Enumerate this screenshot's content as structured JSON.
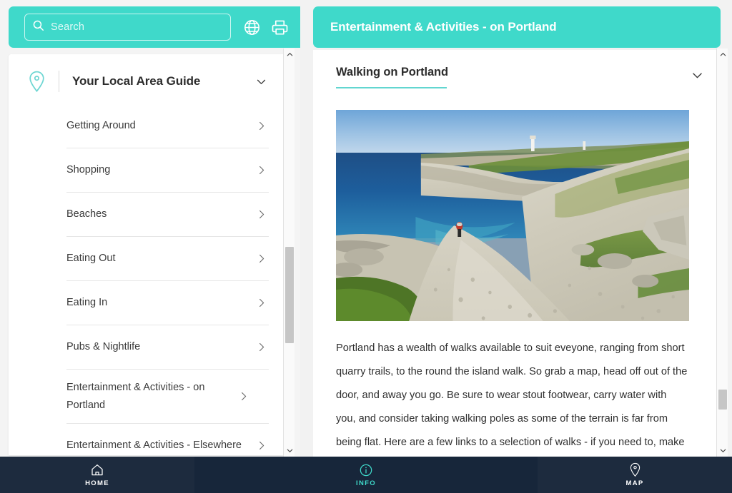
{
  "search": {
    "placeholder": "Search",
    "value": "",
    "icon": "search-icon"
  },
  "header_actions": [
    {
      "name": "globe-icon",
      "label": "Language"
    },
    {
      "name": "printer-icon",
      "label": "Print"
    }
  ],
  "sidebar": {
    "pin_icon": "location-pin-icon",
    "title": "Your Local Area Guide",
    "collapse_icon": "chevron-down-icon",
    "items": [
      {
        "label": "Getting Around",
        "chevron": "chevron-right-icon"
      },
      {
        "label": "Shopping",
        "chevron": "chevron-right-icon"
      },
      {
        "label": "Beaches",
        "chevron": "chevron-right-icon"
      },
      {
        "label": "Eating Out",
        "chevron": "chevron-right-icon"
      },
      {
        "label": "Eating In",
        "chevron": "chevron-right-icon"
      },
      {
        "label": "Pubs & Nightlife",
        "chevron": "chevron-right-icon"
      },
      {
        "label": "Entertainment & Activities - on Portland",
        "chevron": "chevron-right-icon"
      },
      {
        "label": "Entertainment & Activities - Elsewhere",
        "chevron": "chevron-right-icon"
      }
    ]
  },
  "content": {
    "header_title": "Entertainment & Activities - on Portland",
    "article_title": "Walking on Portland",
    "article_collapse_icon": "chevron-down-icon",
    "photo_alt": "Coastal path along limestone cliffs with a walker, Portland",
    "paragraph": "Portland has a wealth of walks available to suit eveyone, ranging from short quarry trails, to the round the island walk. So grab a map, head off out of the door, and away you go. Be sure to wear stout footwear, carry water with you, and consider taking walking poles as some of the terrain is far from being flat. Here are a few links to a selection of walks - if you need to, make sure you print out all maps before you leave home:"
  },
  "bottom_nav": {
    "items": [
      {
        "label": "HOME",
        "icon": "home-icon",
        "active": false
      },
      {
        "label": "INFO",
        "icon": "info-icon",
        "active": true
      },
      {
        "label": "MAP",
        "icon": "map-pin-icon",
        "active": false
      }
    ]
  },
  "colors": {
    "accent_teal": "#3fd9ca",
    "nav_dark": "#1d2b3e",
    "nav_dark_active": "#17263a",
    "text_dark": "#2c2c2c",
    "rule_teal": "#62d6d0"
  },
  "scrollbars": {
    "left": {
      "up_icon": "chevron-up-icon",
      "down_icon": "chevron-down-icon"
    },
    "right": {
      "up_icon": "chevron-up-icon",
      "down_icon": "chevron-down-icon"
    }
  }
}
